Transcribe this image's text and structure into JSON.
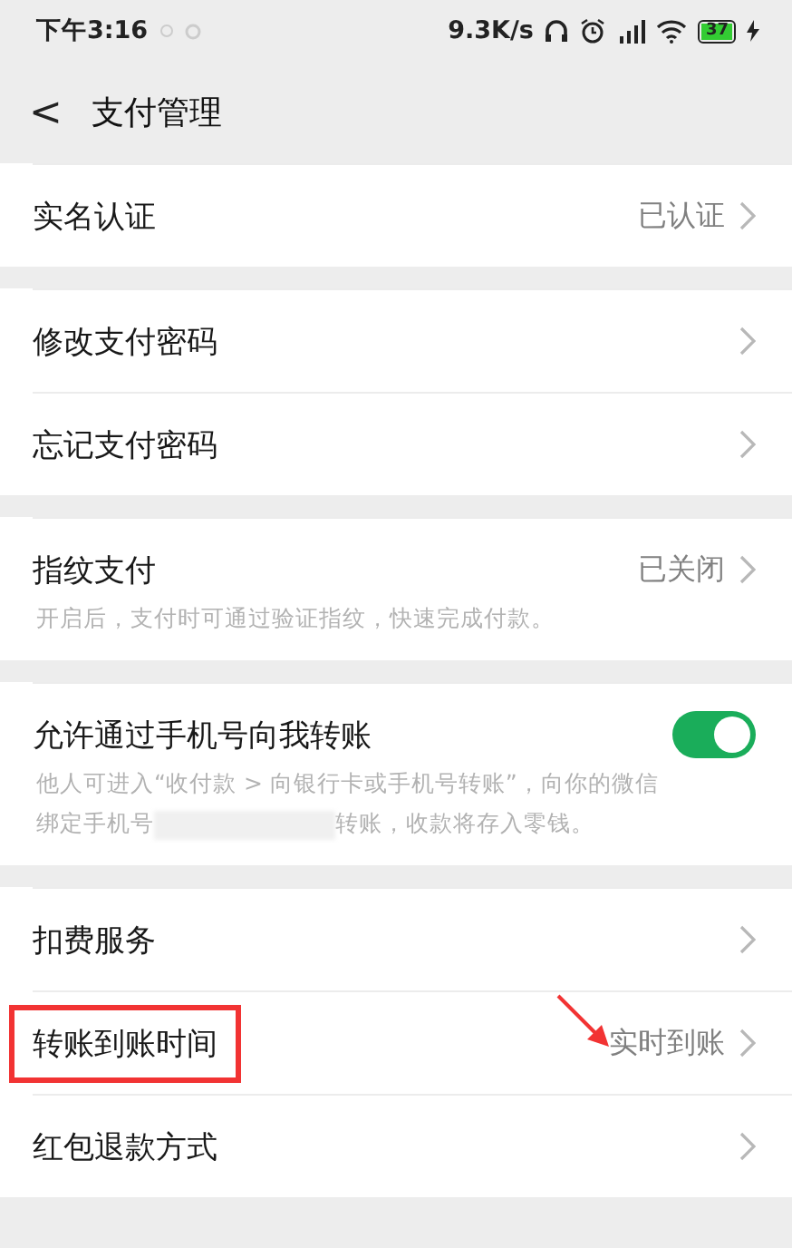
{
  "status_bar": {
    "time": "下午3:16",
    "net_speed": "9.3K/s",
    "battery": "37"
  },
  "header": {
    "back": "<",
    "title": "支付管理"
  },
  "groups": [
    {
      "items": [
        {
          "kind": "link",
          "title": "实名认证",
          "value": "已认证",
          "highlighted": false,
          "arrow": false
        }
      ]
    },
    {
      "items": [
        {
          "kind": "link",
          "title": "修改支付密码",
          "highlighted": false,
          "arrow": false
        },
        {
          "kind": "link",
          "title": "忘记支付密码",
          "highlighted": false,
          "arrow": false
        }
      ]
    },
    {
      "items": [
        {
          "kind": "link",
          "title": "指纹支付",
          "value": "已关闭",
          "description": "开启后，支付时可通过验证指纹，快速完成付款。",
          "highlighted": false,
          "arrow": false
        }
      ]
    },
    {
      "items": [
        {
          "kind": "toggle",
          "title": "允许通过手机号向我转账",
          "on": true,
          "description": "他人可进入“收付款 > 向银行卡或手机号转账”，向你的微信",
          "description_2": "绑定手机号",
          "description_after": "转账，收款将存入零钱。",
          "redacted": true,
          "highlighted": false,
          "arrow": false
        }
      ]
    },
    {
      "items": [
        {
          "kind": "link",
          "title": "扣费服务",
          "highlighted": false,
          "arrow": false
        },
        {
          "kind": "link",
          "title": "转账到账时间",
          "value": "实时到账",
          "highlighted": true,
          "arrow": true
        },
        {
          "kind": "link",
          "title": "红包退款方式",
          "highlighted": false,
          "arrow": false
        }
      ]
    }
  ]
}
